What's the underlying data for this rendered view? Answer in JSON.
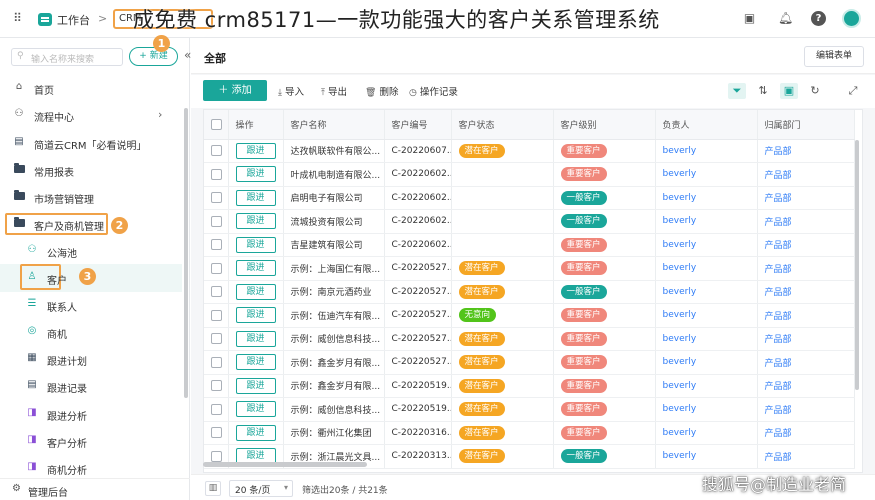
{
  "topbar": {
    "workspace": "工作台",
    "crumb_arrow": ">",
    "crumb_tag": "CRM",
    "overlay_title": "成免费 crm85171—一款功能强大的客户关系管理系统"
  },
  "sidebar": {
    "search_placeholder": "输入名称来搜索",
    "new_label": "+ 新建",
    "collapse": "«",
    "items": [
      {
        "label": "首页",
        "icon": "⌂"
      },
      {
        "label": "流程中心",
        "icon": "⚇"
      },
      {
        "label": "简道云CRM「必看说明」",
        "icon": "▤"
      },
      {
        "label": "常用报表"
      },
      {
        "label": "市场营销管理"
      },
      {
        "label": "客户及商机管理"
      },
      {
        "label": "公海池",
        "icon": "⚇"
      },
      {
        "label": "客户",
        "icon": "♙"
      },
      {
        "label": "联系人",
        "icon": "☰"
      },
      {
        "label": "商机",
        "icon": "◎"
      },
      {
        "label": "跟进计划",
        "icon": "▦"
      },
      {
        "label": "跟进记录",
        "icon": "▤"
      },
      {
        "label": "跟进分析",
        "icon": "◨"
      },
      {
        "label": "客户分析",
        "icon": "◨"
      },
      {
        "label": "商机分析",
        "icon": "◨"
      }
    ],
    "markers": [
      "1",
      "2",
      "3"
    ],
    "footer": "管理后台"
  },
  "main": {
    "all_label": "全部",
    "edit_form": "编辑表单",
    "toolbar": {
      "add": "＋ 添加",
      "import": "导入",
      "export": "导出",
      "delete": "删除",
      "log": "操作记录"
    },
    "columns": [
      "操作",
      "客户名称",
      "客户编号",
      "客户状态",
      "客户级别",
      "负责人",
      "归属部门"
    ],
    "follow_label": "跟进",
    "rows": [
      {
        "name": "达孜帆联软件有限公...",
        "code": "C-20220607...",
        "status": "潜在客户",
        "level": "重要客户",
        "owner": "beverly",
        "dept": "产品部"
      },
      {
        "name": "叶成机电制造有限公...",
        "code": "C-20220602...",
        "status": "",
        "level": "重要客户",
        "owner": "beverly",
        "dept": "产品部"
      },
      {
        "name": "启明电子有限公司",
        "code": "C-20220602...",
        "status": "",
        "level": "一般客户",
        "owner": "beverly",
        "dept": "产品部"
      },
      {
        "name": "流城投资有限公司",
        "code": "C-20220602...",
        "status": "",
        "level": "一般客户",
        "owner": "beverly",
        "dept": "产品部"
      },
      {
        "name": "吉星建筑有限公司",
        "code": "C-20220602...",
        "status": "",
        "level": "重要客户",
        "owner": "beverly",
        "dept": "产品部"
      },
      {
        "name": "示例：上海国仁有限...",
        "code": "C-20220527...",
        "status": "潜在客户",
        "level": "重要客户",
        "owner": "beverly",
        "dept": "产品部"
      },
      {
        "name": "示例：南京元酒药业",
        "code": "C-20220527...",
        "status": "潜在客户",
        "level": "一般客户",
        "owner": "beverly",
        "dept": "产品部"
      },
      {
        "name": "示例：伍迪汽车有限...",
        "code": "C-20220527...",
        "status": "无意向",
        "level": "重要客户",
        "owner": "beverly",
        "dept": "产品部"
      },
      {
        "name": "示例：威创信息科技...",
        "code": "C-20220527...",
        "status": "潜在客户",
        "level": "重要客户",
        "owner": "beverly",
        "dept": "产品部"
      },
      {
        "name": "示例：鑫金岁月有限...",
        "code": "C-20220527...",
        "status": "潜在客户",
        "level": "重要客户",
        "owner": "beverly",
        "dept": "产品部"
      },
      {
        "name": "示例：鑫金岁月有限...",
        "code": "C-20220519...",
        "status": "潜在客户",
        "level": "重要客户",
        "owner": "beverly",
        "dept": "产品部"
      },
      {
        "name": "示例：威创信息科技...",
        "code": "C-20220519...",
        "status": "潜在客户",
        "level": "重要客户",
        "owner": "beverly",
        "dept": "产品部"
      },
      {
        "name": "示例：衢州江化集团",
        "code": "C-20220316...",
        "status": "潜在客户",
        "level": "重要客户",
        "owner": "beverly",
        "dept": "产品部"
      },
      {
        "name": "示例：浙江晨光文具...",
        "code": "C-20220313...",
        "status": "潜在客户",
        "level": "一般客户",
        "owner": "beverly",
        "dept": "产品部"
      }
    ],
    "footer": {
      "page_size": "20 条/页",
      "info": "筛选出20条 / 共21条"
    }
  },
  "colors": {
    "accent": "#1aa69a",
    "potential": "#f5a623",
    "important": "#f0877b",
    "normal": "#1aa69a",
    "no_intent": "#52c41a",
    "highlight": "#f0a248"
  },
  "watermark": "搜狐号@制造业老简"
}
